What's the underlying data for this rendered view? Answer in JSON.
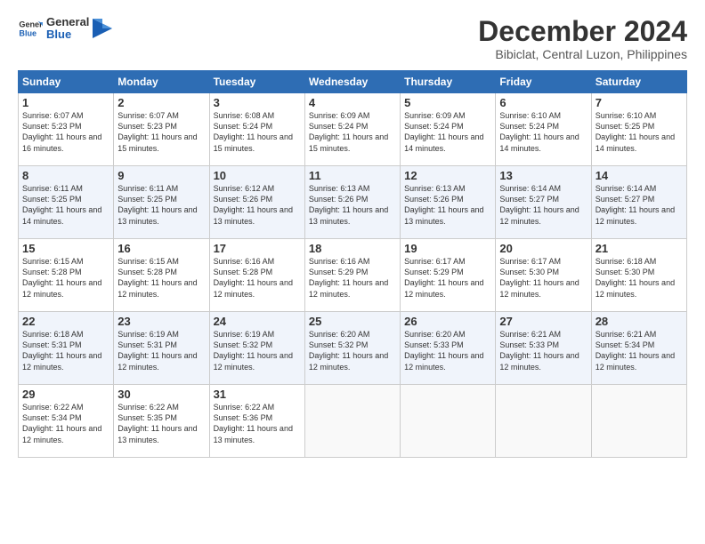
{
  "logo": {
    "line1": "General",
    "line2": "Blue"
  },
  "title": "December 2024",
  "location": "Bibiclat, Central Luzon, Philippines",
  "days_of_week": [
    "Sunday",
    "Monday",
    "Tuesday",
    "Wednesday",
    "Thursday",
    "Friday",
    "Saturday"
  ],
  "weeks": [
    [
      {
        "day": "1",
        "sunrise": "6:07 AM",
        "sunset": "5:23 PM",
        "daylight": "11 hours and 16 minutes."
      },
      {
        "day": "2",
        "sunrise": "6:07 AM",
        "sunset": "5:23 PM",
        "daylight": "11 hours and 15 minutes."
      },
      {
        "day": "3",
        "sunrise": "6:08 AM",
        "sunset": "5:24 PM",
        "daylight": "11 hours and 15 minutes."
      },
      {
        "day": "4",
        "sunrise": "6:09 AM",
        "sunset": "5:24 PM",
        "daylight": "11 hours and 15 minutes."
      },
      {
        "day": "5",
        "sunrise": "6:09 AM",
        "sunset": "5:24 PM",
        "daylight": "11 hours and 14 minutes."
      },
      {
        "day": "6",
        "sunrise": "6:10 AM",
        "sunset": "5:24 PM",
        "daylight": "11 hours and 14 minutes."
      },
      {
        "day": "7",
        "sunrise": "6:10 AM",
        "sunset": "5:25 PM",
        "daylight": "11 hours and 14 minutes."
      }
    ],
    [
      {
        "day": "8",
        "sunrise": "6:11 AM",
        "sunset": "5:25 PM",
        "daylight": "11 hours and 14 minutes."
      },
      {
        "day": "9",
        "sunrise": "6:11 AM",
        "sunset": "5:25 PM",
        "daylight": "11 hours and 13 minutes."
      },
      {
        "day": "10",
        "sunrise": "6:12 AM",
        "sunset": "5:26 PM",
        "daylight": "11 hours and 13 minutes."
      },
      {
        "day": "11",
        "sunrise": "6:13 AM",
        "sunset": "5:26 PM",
        "daylight": "11 hours and 13 minutes."
      },
      {
        "day": "12",
        "sunrise": "6:13 AM",
        "sunset": "5:26 PM",
        "daylight": "11 hours and 13 minutes."
      },
      {
        "day": "13",
        "sunrise": "6:14 AM",
        "sunset": "5:27 PM",
        "daylight": "11 hours and 12 minutes."
      },
      {
        "day": "14",
        "sunrise": "6:14 AM",
        "sunset": "5:27 PM",
        "daylight": "11 hours and 12 minutes."
      }
    ],
    [
      {
        "day": "15",
        "sunrise": "6:15 AM",
        "sunset": "5:28 PM",
        "daylight": "11 hours and 12 minutes."
      },
      {
        "day": "16",
        "sunrise": "6:15 AM",
        "sunset": "5:28 PM",
        "daylight": "11 hours and 12 minutes."
      },
      {
        "day": "17",
        "sunrise": "6:16 AM",
        "sunset": "5:28 PM",
        "daylight": "11 hours and 12 minutes."
      },
      {
        "day": "18",
        "sunrise": "6:16 AM",
        "sunset": "5:29 PM",
        "daylight": "11 hours and 12 minutes."
      },
      {
        "day": "19",
        "sunrise": "6:17 AM",
        "sunset": "5:29 PM",
        "daylight": "11 hours and 12 minutes."
      },
      {
        "day": "20",
        "sunrise": "6:17 AM",
        "sunset": "5:30 PM",
        "daylight": "11 hours and 12 minutes."
      },
      {
        "day": "21",
        "sunrise": "6:18 AM",
        "sunset": "5:30 PM",
        "daylight": "11 hours and 12 minutes."
      }
    ],
    [
      {
        "day": "22",
        "sunrise": "6:18 AM",
        "sunset": "5:31 PM",
        "daylight": "11 hours and 12 minutes."
      },
      {
        "day": "23",
        "sunrise": "6:19 AM",
        "sunset": "5:31 PM",
        "daylight": "11 hours and 12 minutes."
      },
      {
        "day": "24",
        "sunrise": "6:19 AM",
        "sunset": "5:32 PM",
        "daylight": "11 hours and 12 minutes."
      },
      {
        "day": "25",
        "sunrise": "6:20 AM",
        "sunset": "5:32 PM",
        "daylight": "11 hours and 12 minutes."
      },
      {
        "day": "26",
        "sunrise": "6:20 AM",
        "sunset": "5:33 PM",
        "daylight": "11 hours and 12 minutes."
      },
      {
        "day": "27",
        "sunrise": "6:21 AM",
        "sunset": "5:33 PM",
        "daylight": "11 hours and 12 minutes."
      },
      {
        "day": "28",
        "sunrise": "6:21 AM",
        "sunset": "5:34 PM",
        "daylight": "11 hours and 12 minutes."
      }
    ],
    [
      {
        "day": "29",
        "sunrise": "6:22 AM",
        "sunset": "5:34 PM",
        "daylight": "11 hours and 12 minutes."
      },
      {
        "day": "30",
        "sunrise": "6:22 AM",
        "sunset": "5:35 PM",
        "daylight": "11 hours and 13 minutes."
      },
      {
        "day": "31",
        "sunrise": "6:22 AM",
        "sunset": "5:36 PM",
        "daylight": "11 hours and 13 minutes."
      },
      null,
      null,
      null,
      null
    ]
  ]
}
